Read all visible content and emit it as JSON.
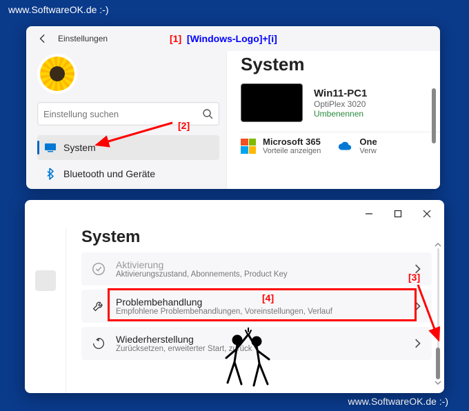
{
  "watermark": {
    "text": "www.SoftwareOK.de :-)"
  },
  "annotations": {
    "a1": "[1]",
    "a1_label": "[Windows-Logo]+[i]",
    "a2": "[2]",
    "a3": "[3]",
    "a4": "[4]"
  },
  "window1": {
    "title": "Einstellungen",
    "search": {
      "placeholder": "Einstellung suchen"
    },
    "nav": {
      "system": "System",
      "bluetooth": "Bluetooth und Geräte"
    },
    "right": {
      "heading": "System",
      "device": {
        "name": "Win11-PC1",
        "model": "OptiPlex 3020",
        "rename": "Umbenennen"
      },
      "tiles": {
        "ms365": {
          "title": "Microsoft 365",
          "sub": "Vorteile anzeigen"
        },
        "onedrive": {
          "title": "One",
          "sub": "Verw"
        }
      }
    }
  },
  "window2": {
    "heading": "System",
    "items": {
      "activation": {
        "title": "Aktivierung",
        "sub": "Aktivierungszustand, Abonnements, Product Key"
      },
      "troubleshoot": {
        "title": "Problembehandlung",
        "sub": "Empfohlene Problembehandlungen, Voreinstellungen, Verlauf"
      },
      "recovery": {
        "title": "Wiederherstellung",
        "sub": "Zurücksetzen, erweiterter Start, zurück"
      }
    }
  }
}
